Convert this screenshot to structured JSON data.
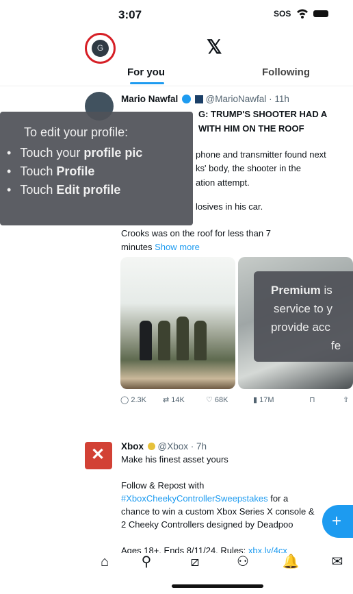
{
  "status": {
    "time": "3:07",
    "sos": "SOS"
  },
  "header": {
    "avatar_letter": "G",
    "logo": "𝕏"
  },
  "tabs": [
    {
      "label": "For you"
    },
    {
      "label": "Following"
    }
  ],
  "post1": {
    "name": "Mario Nawfal",
    "handle": "@MarioNawfal",
    "time": "· 11h",
    "headline1": "G: TRUMP'S SHOOTER HAD A",
    "headline2": "WITH HIM ON THE ROOF",
    "line3": "phone and transmitter found next",
    "line4": "ks' body, the shooter in the",
    "line5": "ation attempt.",
    "line6": "losives in his car.",
    "line7": "Crooks was on the roof for less than 7",
    "line8_text": "minutes ",
    "line8_link": "Show more",
    "stats": {
      "replies": "2.3K",
      "reposts": "14K",
      "likes": "68K",
      "views": "17M"
    }
  },
  "post2": {
    "name": "Xbox",
    "handle": "@Xbox",
    "time": "· 7h",
    "line1": "Make his finest asset yours",
    "line2": "Follow & Repost with",
    "hashtag": "#XboxCheekyControllerSweepstakes",
    "line3_tail": " for a",
    "line4": "chance to win a custom Xbox Series X console &",
    "line5": "2 Cheeky Controllers designed by Deadpoo",
    "line6": "Ages 18+. Ends 8/11/24. Rules: ",
    "line6_link": "xbx.lv/4cx"
  },
  "tooltip": {
    "title": "To edit your profile:",
    "items": [
      {
        "prefix": "Touch your ",
        "bold": "profile pic"
      },
      {
        "prefix": "Touch ",
        "bold": "Profile"
      },
      {
        "prefix": "Touch ",
        "bold": "Edit profile"
      }
    ]
  },
  "premium_overlay": {
    "line1_bold": "Premium",
    "line1_rest": " is",
    "line2": "service to y",
    "line3": "provide acc",
    "line4": "fe"
  },
  "nav": [
    {
      "icon": "home-icon"
    },
    {
      "icon": "search-icon"
    },
    {
      "icon": "grok-icon"
    },
    {
      "icon": "communities-icon"
    },
    {
      "icon": "notifications-icon"
    },
    {
      "icon": "messages-icon"
    }
  ],
  "colors": {
    "accent": "#1d9bf0",
    "avatar_ring": "#d61f26",
    "xbox": "#d24135"
  }
}
